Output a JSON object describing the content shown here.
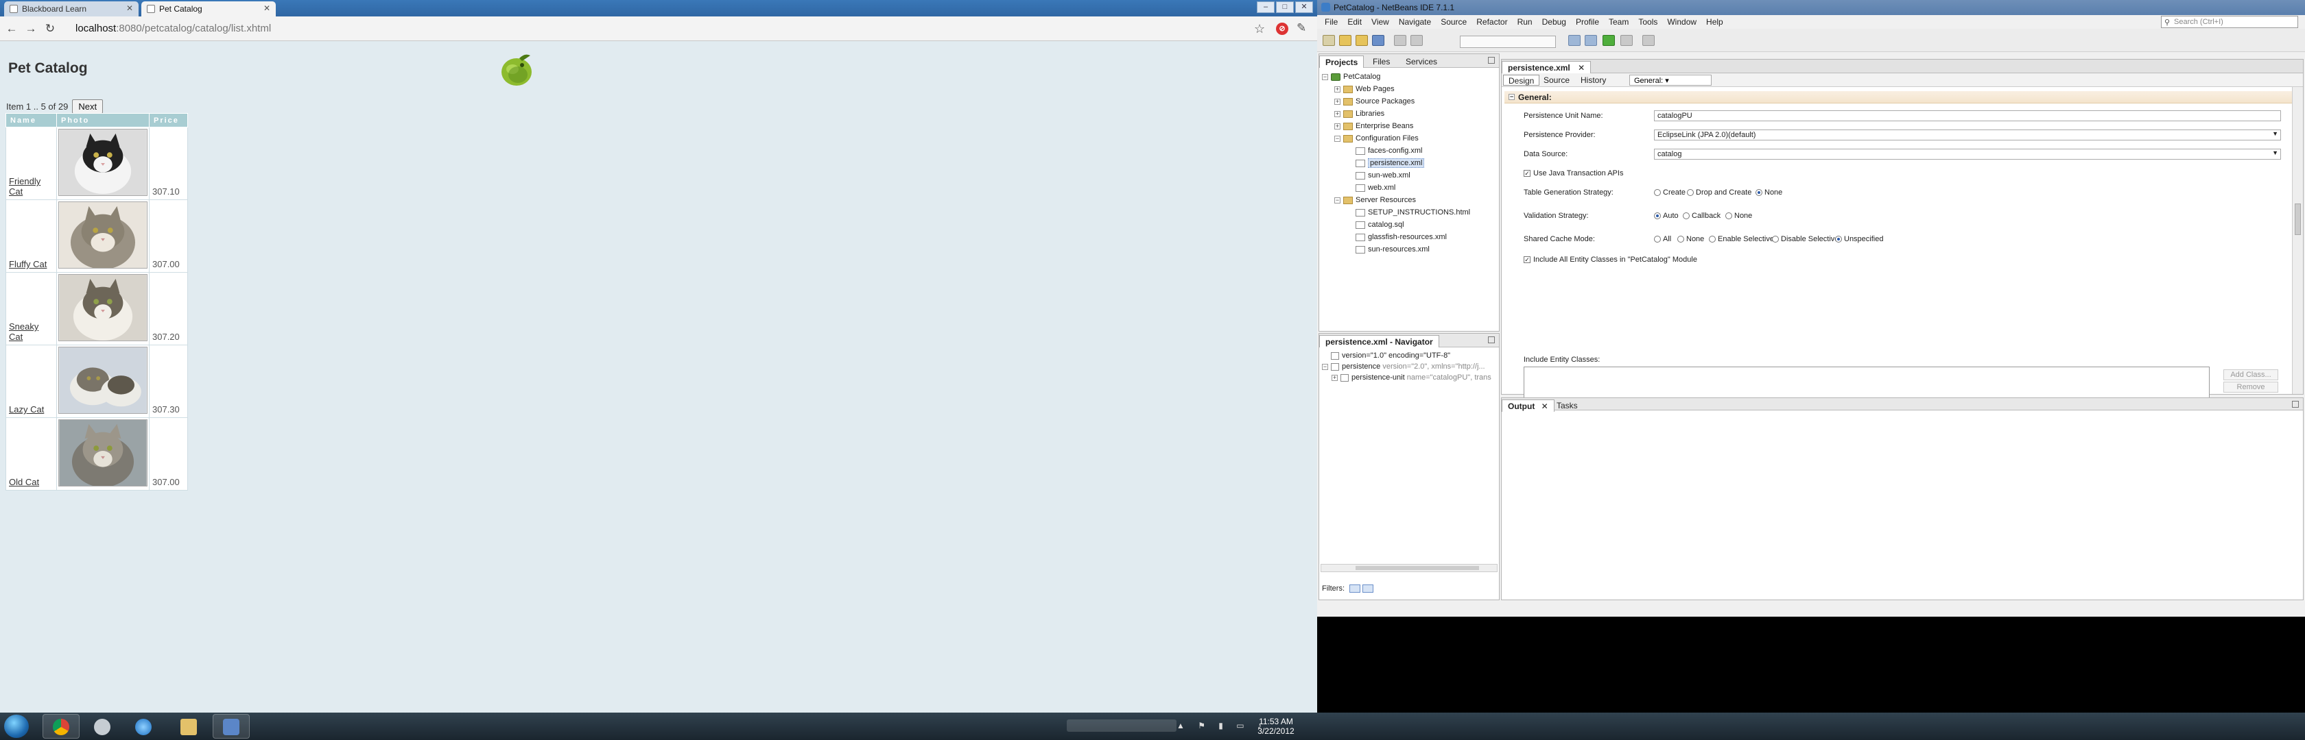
{
  "browser": {
    "tabs": [
      {
        "label": "Blackboard Learn",
        "active": false
      },
      {
        "label": "Pet Catalog",
        "active": true
      }
    ],
    "url_host": "localhost",
    "url_path": ":8080/petcatalog/catalog/list.xhtml"
  },
  "page": {
    "title": "Pet Catalog",
    "pager_text": "Item 1 .. 5 of 29",
    "next_label": "Next",
    "columns": [
      "Name",
      "Photo",
      "Price"
    ],
    "rows": [
      {
        "name": "Friendly Cat",
        "price": "307.10"
      },
      {
        "name": "Fluffy Cat",
        "price": "307.00"
      },
      {
        "name": "Sneaky Cat",
        "price": "307.20"
      },
      {
        "name": "Lazy Cat",
        "price": "307.30"
      },
      {
        "name": "Old Cat",
        "price": "307.00"
      }
    ]
  },
  "ide": {
    "title": "PetCatalog - NetBeans IDE 7.1.1",
    "menu": [
      "File",
      "Edit",
      "View",
      "Navigate",
      "Source",
      "Refactor",
      "Run",
      "Debug",
      "Profile",
      "Team",
      "Tools",
      "Window",
      "Help"
    ],
    "search_placeholder": "Search (Ctrl+I)",
    "project_tabs": [
      "Projects",
      "Files",
      "Services"
    ],
    "tree": [
      {
        "label": "PetCatalog",
        "depth": 0,
        "icon": "proj",
        "exp": "-"
      },
      {
        "label": "Web Pages",
        "depth": 1,
        "icon": "folder",
        "exp": "+"
      },
      {
        "label": "Source Packages",
        "depth": 1,
        "icon": "folder",
        "exp": "+"
      },
      {
        "label": "Libraries",
        "depth": 1,
        "icon": "folder",
        "exp": "+"
      },
      {
        "label": "Enterprise Beans",
        "depth": 1,
        "icon": "folder",
        "exp": "+"
      },
      {
        "label": "Configuration Files",
        "depth": 1,
        "icon": "folder",
        "exp": "-"
      },
      {
        "label": "faces-config.xml",
        "depth": 2,
        "icon": "xml",
        "exp": ""
      },
      {
        "label": "persistence.xml",
        "depth": 2,
        "icon": "xml",
        "exp": "",
        "selected": true
      },
      {
        "label": "sun-web.xml",
        "depth": 2,
        "icon": "xml",
        "exp": ""
      },
      {
        "label": "web.xml",
        "depth": 2,
        "icon": "xml",
        "exp": ""
      },
      {
        "label": "Server Resources",
        "depth": 1,
        "icon": "folder",
        "exp": "-"
      },
      {
        "label": "SETUP_INSTRUCTIONS.html",
        "depth": 2,
        "icon": "xml",
        "exp": ""
      },
      {
        "label": "catalog.sql",
        "depth": 2,
        "icon": "xml",
        "exp": ""
      },
      {
        "label": "glassfish-resources.xml",
        "depth": 2,
        "icon": "xml",
        "exp": ""
      },
      {
        "label": "sun-resources.xml",
        "depth": 2,
        "icon": "xml",
        "exp": ""
      }
    ],
    "navigator_title": "persistence.xml - Navigator",
    "navigator": [
      {
        "label": "version=\"1.0\" encoding=\"UTF-8\"",
        "attr": "",
        "depth": 0,
        "exp": ""
      },
      {
        "label": "persistence",
        "attr": " version=\"2.0\", xmlns=\"http://j...",
        "depth": 0,
        "exp": "-"
      },
      {
        "label": "persistence-unit",
        "attr": " name=\"catalogPU\", trans",
        "depth": 1,
        "exp": "+"
      }
    ],
    "filters_label": "Filters:",
    "editor_tab": "persistence.xml",
    "editor_views": [
      "Design",
      "Source",
      "History"
    ],
    "section_combo": "General:",
    "section_title": "General:",
    "fields": {
      "unit_name_label": "Persistence Unit Name:",
      "unit_name_value": "catalogPU",
      "provider_label": "Persistence Provider:",
      "provider_value": "EclipseLink (JPA 2.0)(default)",
      "datasource_label": "Data Source:",
      "datasource_value": "catalog",
      "jta_label": "Use Java Transaction APIs",
      "table_gen_label": "Table Generation Strategy:",
      "table_gen_options": [
        "Create",
        "Drop and Create",
        "None"
      ],
      "validation_label": "Validation Strategy:",
      "validation_options": [
        "Auto",
        "Callback",
        "None"
      ],
      "cache_label": "Shared Cache Mode:",
      "cache_options": [
        "All",
        "None",
        "Enable Selective",
        "Disable Selective",
        "Unspecified"
      ],
      "include_all_label": "Include All Entity Classes in \"PetCatalog\" Module",
      "include_entity_label": "Include Entity Classes:",
      "add_class_label": "Add Class...",
      "remove_label": "Remove"
    },
    "output_tabs": [
      "Output",
      "Tasks"
    ]
  },
  "taskbar": {
    "time": "11:53 AM",
    "date": "3/22/2012"
  }
}
